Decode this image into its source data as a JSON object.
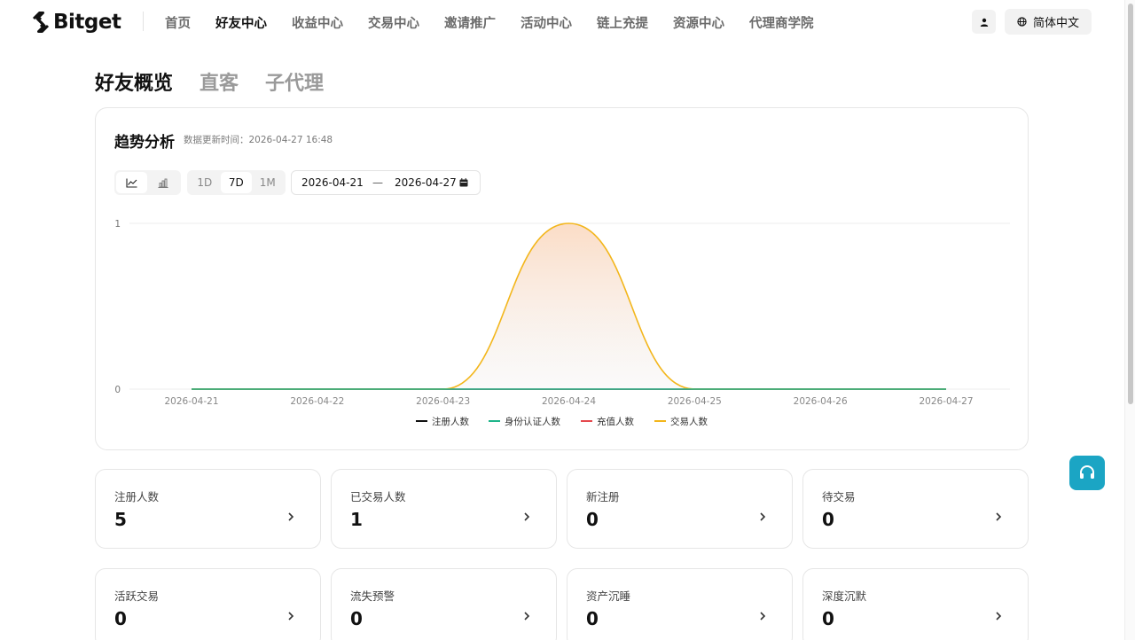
{
  "brand": {
    "name": "Bitget"
  },
  "nav": {
    "items": [
      {
        "label": "首页",
        "active": false
      },
      {
        "label": "好友中心",
        "active": true
      },
      {
        "label": "收益中心",
        "active": false
      },
      {
        "label": "交易中心",
        "active": false
      },
      {
        "label": "邀请推广",
        "active": false
      },
      {
        "label": "活动中心",
        "active": false
      },
      {
        "label": "链上充提",
        "active": false
      },
      {
        "label": "资源中心",
        "active": false
      },
      {
        "label": "代理商学院",
        "active": false
      }
    ],
    "user_icon": "user-icon",
    "language": {
      "label": "简体中文",
      "icon": "globe-icon"
    }
  },
  "page_tabs": [
    {
      "label": "好友概览",
      "active": true
    },
    {
      "label": "直客",
      "active": false
    },
    {
      "label": "子代理",
      "active": false
    }
  ],
  "trend": {
    "title": "趋势分析",
    "updated": "数据更新时间：2026-04-27 16:48",
    "chart_type_toggle": [
      {
        "icon": "line-chart-icon",
        "active": true
      },
      {
        "icon": "bar-chart-icon",
        "active": false
      }
    ],
    "ranges": [
      {
        "label": "1D",
        "active": false
      },
      {
        "label": "7D",
        "active": true
      },
      {
        "label": "1M",
        "active": false
      }
    ],
    "date_start": "2026-04-21",
    "date_separator": "—",
    "date_end": "2026-04-27"
  },
  "chart_data": {
    "type": "line",
    "x": [
      "2026-04-21",
      "2026-04-22",
      "2026-04-23",
      "2026-04-24",
      "2026-04-25",
      "2026-04-26",
      "2026-04-27"
    ],
    "yticks": [
      0,
      1
    ],
    "ylim": [
      0,
      1
    ],
    "grid": true,
    "smooth": true,
    "legend_position": "bottom",
    "series": [
      {
        "name": "注册人数",
        "color": "#111111",
        "values": [
          0,
          0,
          0,
          0,
          0,
          0,
          0
        ]
      },
      {
        "name": "身份认证人数",
        "color": "#1fb58a",
        "values": [
          0,
          0,
          0,
          0,
          0,
          0,
          0
        ]
      },
      {
        "name": "充值人数",
        "color": "#e5484d",
        "values": [
          0,
          0,
          0,
          0,
          0,
          0,
          0
        ]
      },
      {
        "name": "交易人数",
        "color": "#f3b61b",
        "values": [
          0,
          0,
          0,
          1,
          0,
          0,
          0
        ]
      }
    ]
  },
  "stats": [
    {
      "label": "注册人数",
      "value": "5"
    },
    {
      "label": "已交易人数",
      "value": "1"
    },
    {
      "label": "新注册",
      "value": "0"
    },
    {
      "label": "待交易",
      "value": "0"
    },
    {
      "label": "活跃交易",
      "value": "0"
    },
    {
      "label": "流失预警",
      "value": "0"
    },
    {
      "label": "资产沉睡",
      "value": "0"
    },
    {
      "label": "深度沉默",
      "value": "0"
    }
  ],
  "support": {
    "icon": "headset-icon"
  }
}
